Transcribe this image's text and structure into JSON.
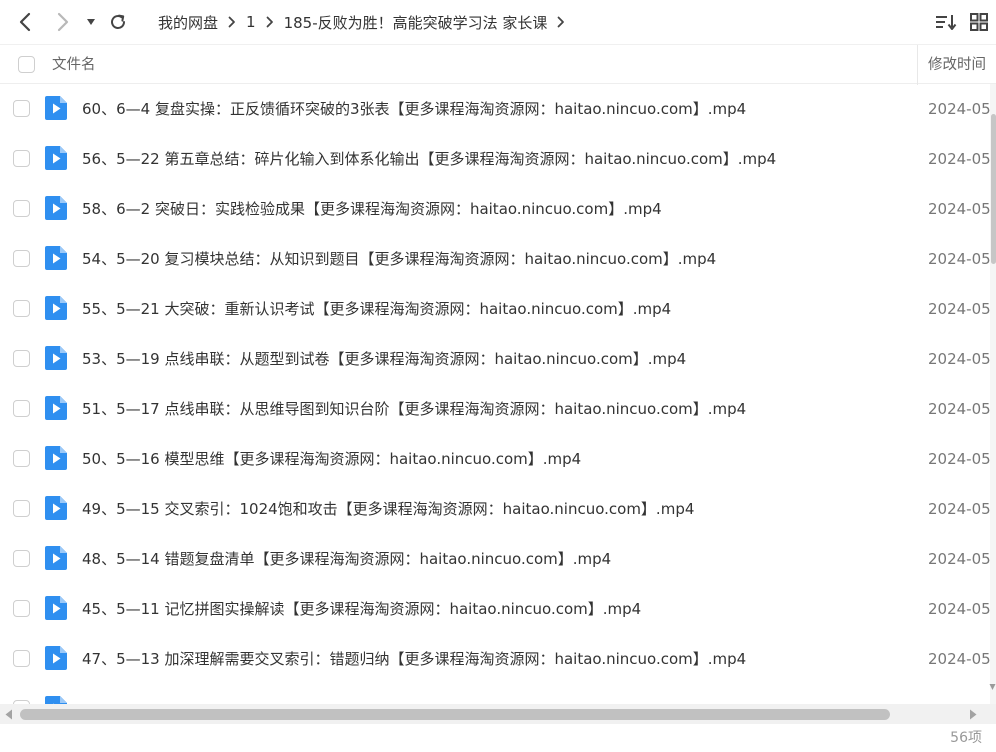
{
  "toolbar": {
    "back_icon": "chevron-left-icon",
    "forward_icon": "chevron-right-icon",
    "dropdown_icon": "caret-down-icon",
    "refresh_icon": "refresh-icon",
    "sort_icon": "sort-icon",
    "grid_icon": "grid-view-icon"
  },
  "breadcrumb": [
    "我的网盘",
    "1",
    "185-反败为胜！高能突破学习法 家长课"
  ],
  "header": {
    "name_label": "文件名",
    "time_label": "修改时间"
  },
  "files": [
    {
      "name": "60、6—4 复盘实操：正反馈循环突破的3张表【更多课程海淘资源网：haitao.nincuo.com】.mp4",
      "time": "2024-05"
    },
    {
      "name": "56、5—22 第五章总结：碎片化输入到体系化输出【更多课程海淘资源网：haitao.nincuo.com】.mp4",
      "time": "2024-05"
    },
    {
      "name": "58、6—2 突破日：实践检验成果【更多课程海淘资源网：haitao.nincuo.com】.mp4",
      "time": "2024-05"
    },
    {
      "name": "54、5—20 复习模块总结：从知识到题目【更多课程海淘资源网：haitao.nincuo.com】.mp4",
      "time": "2024-05"
    },
    {
      "name": "55、5—21 大突破：重新认识考试【更多课程海淘资源网：haitao.nincuo.com】.mp4",
      "time": "2024-05"
    },
    {
      "name": "53、5—19 点线串联：从题型到试卷【更多课程海淘资源网：haitao.nincuo.com】.mp4",
      "time": "2024-05"
    },
    {
      "name": "51、5—17 点线串联：从思维导图到知识台阶【更多课程海淘资源网：haitao.nincuo.com】.mp4",
      "time": "2024-05"
    },
    {
      "name": "50、5—16 模型思维【更多课程海淘资源网：haitao.nincuo.com】.mp4",
      "time": "2024-05"
    },
    {
      "name": "49、5—15 交叉索引：1024饱和攻击【更多课程海淘资源网：haitao.nincuo.com】.mp4",
      "time": "2024-05"
    },
    {
      "name": "48、5—14 错题复盘清单【更多课程海淘资源网：haitao.nincuo.com】.mp4",
      "time": "2024-05"
    },
    {
      "name": "45、5—11 记忆拼图实操解读【更多课程海淘资源网：haitao.nincuo.com】.mp4",
      "time": "2024-05"
    },
    {
      "name": "47、5—13 加深理解需要交叉索引：错题归纳【更多课程海淘资源网：haitao.nincuo.com】.mp4",
      "time": "2024-05"
    }
  ],
  "status": {
    "count": "56项"
  },
  "colors": {
    "video_icon": "#2f8ff0",
    "video_icon_fold": "#9cc9f8",
    "scroll_thumb": "#c1c1c1"
  }
}
